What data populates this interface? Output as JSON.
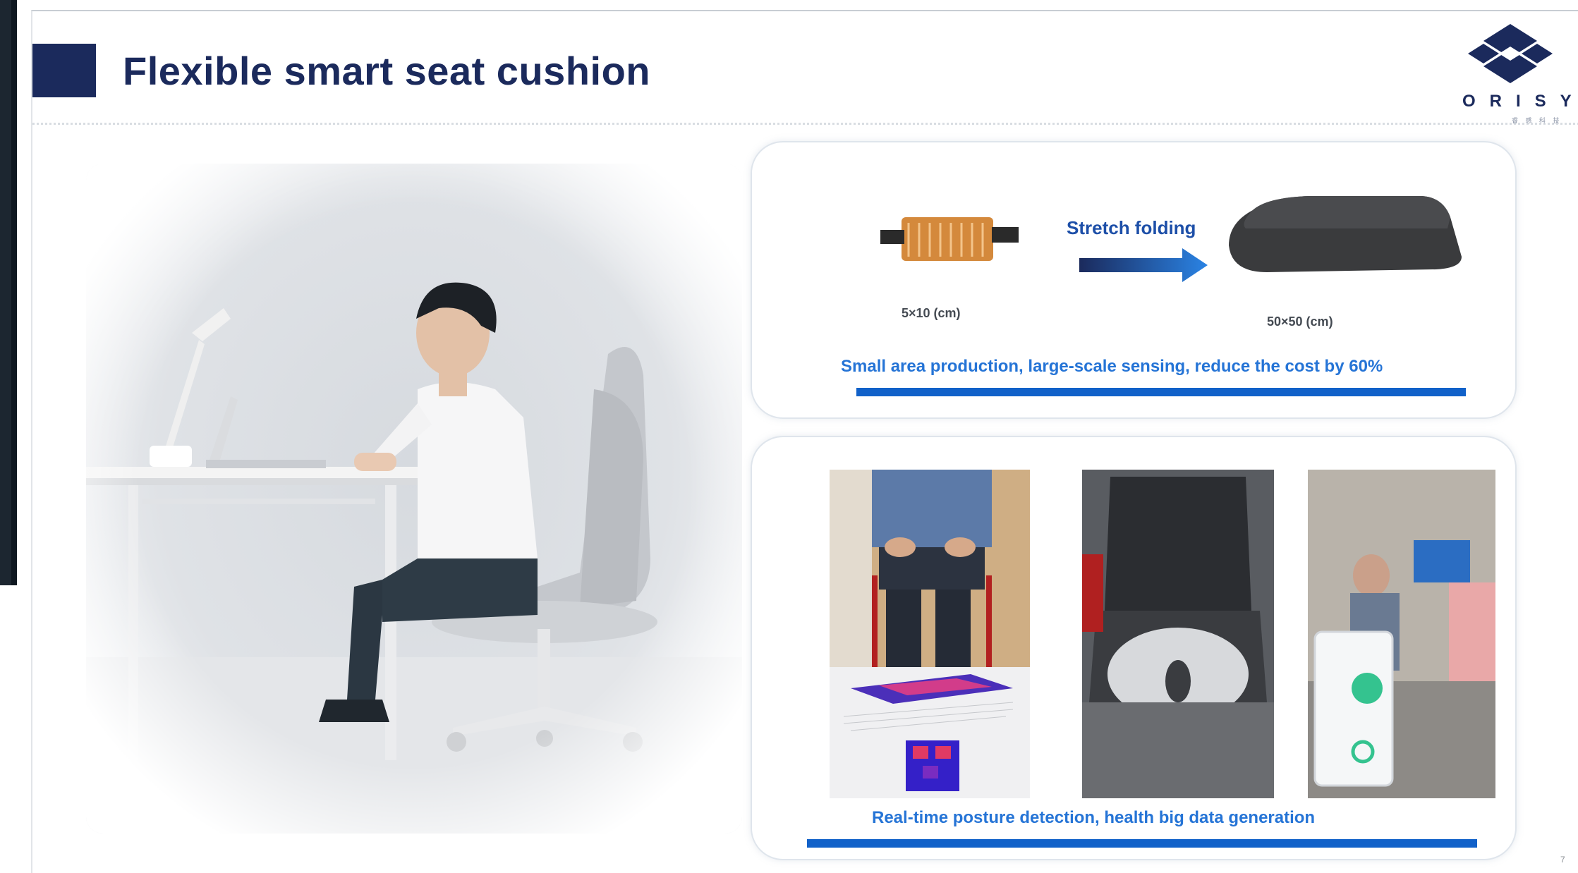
{
  "slide": {
    "title": "Flexible smart seat cushion",
    "page_number": "7"
  },
  "logo": {
    "name": "ORISYS",
    "subtitle": "睿 感 科 技",
    "icon": "diamond-knot-logo-icon"
  },
  "top_panel": {
    "small_size_label": "5×10 (cm)",
    "arrow_label": "Stretch folding",
    "large_size_label": "50×50 (cm)",
    "caption": "Small area production, large-scale sensing, reduce the cost by 60%"
  },
  "bottom_panel": {
    "caption": "Real-time posture detection, health big data generation"
  },
  "colors": {
    "brand_navy": "#1b2a5c",
    "accent_blue": "#2574d6",
    "bar_blue": "#1161c9"
  }
}
